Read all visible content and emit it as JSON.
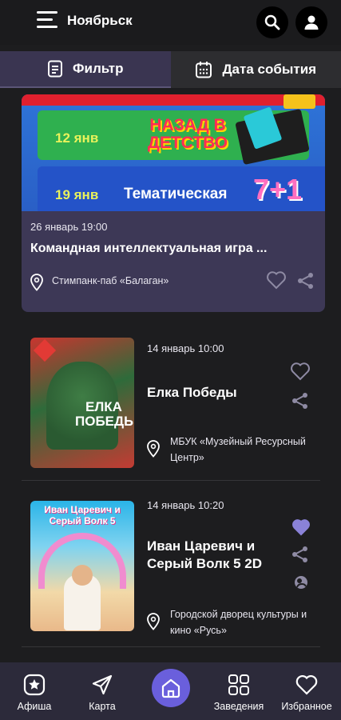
{
  "header": {
    "city": "Ноябрьск",
    "icons": [
      "menu-icon",
      "search-icon",
      "user-icon"
    ]
  },
  "tabs": [
    {
      "label": "Фильтр",
      "icon": "filter-icon",
      "active": true
    },
    {
      "label": "Дата события",
      "icon": "calendar-icon",
      "active": false
    }
  ],
  "featured": {
    "banner": {
      "row1_date": "12 янв",
      "row1_title": "НАЗАД В ДЕТСТВО",
      "row2_date": "19 янв",
      "row2_title": "Тематическая",
      "row2_badge": "7+1"
    },
    "date": "26 январь 19:00",
    "title": "Командная интеллектуальная игра ...",
    "place": "Стимпанк-паб «Балаган»",
    "liked": false
  },
  "events": [
    {
      "date": "14 январь 10:00",
      "title": "Елка Победы",
      "place": "МБУК «Музейный Ресурсный Центр»",
      "poster_text": "ЕЛКА ПОБЕДЫ",
      "liked": false,
      "icons": [
        "heart-icon",
        "share-icon"
      ]
    },
    {
      "date": "14 январь 10:20",
      "title": "Иван Царевич и Серый Волк 5 2D",
      "place": "Городской дворец культуры и кино «Русь»",
      "poster_text": "Иван Царевич и Серый Волк 5",
      "liked": true,
      "icons": [
        "heart-icon",
        "share-icon",
        "pushkin-card-icon"
      ]
    }
  ],
  "bottom_nav": [
    {
      "label": "Афиша",
      "icon": "poster-icon",
      "active": true
    },
    {
      "label": "Карта",
      "icon": "map-arrow-icon",
      "active": false
    },
    {
      "label": "",
      "icon": "home-icon",
      "active": false
    },
    {
      "label": "Заведения",
      "icon": "grid-icon",
      "active": false
    },
    {
      "label": "Избранное",
      "icon": "heart-icon",
      "active": false
    }
  ],
  "colors": {
    "background": "#1d1d1f",
    "card": "#3d3856",
    "accent": "#6a5fdc",
    "liked": "#8a82d8",
    "nav": "#2c2a3a"
  }
}
